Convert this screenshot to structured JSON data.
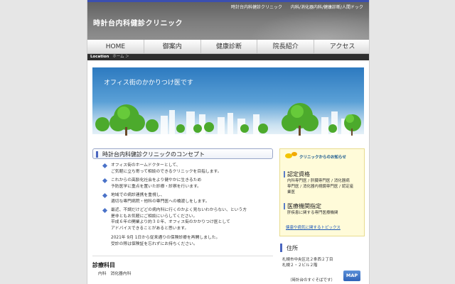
{
  "header": {
    "tagline_left": "時計台内科健診クリニック",
    "tagline_right": "内科/消化器内科/健康診断/人間ドック",
    "site_title": "時計台内科健診クリニック"
  },
  "nav": {
    "items": [
      "HOME",
      "御案内",
      "健康診断",
      "院長紹介",
      "アクセス"
    ]
  },
  "location_bar": {
    "label": "Location",
    "crumb": "ホーム ＞"
  },
  "hero": {
    "text": "オフィス街のかかりつけ医です"
  },
  "concept": {
    "title": "時計台内科健診クリニックのコンセプト",
    "paragraphs": [
      [
        "オフィス街のホームドクターとして、",
        "ご気軽に立ち寄って相談のできるクリニックを目指します。"
      ],
      [
        "これからの高齢化社会をより健やかに生きるため",
        "予防医学に重点を置いた診療・診察を行います。"
      ],
      [
        "地域での病診連携を重視し、",
        "適切な専門病院・他科の専門医への橋渡しをします。"
      ],
      [
        "最近、不調だけどどの病内科に行くのかよく見ないわからない、という方",
        "是非ともお気軽にご相談にいらしてください。",
        "平成６年の開業より約３０年、オフィス街のかかりつけ医として",
        "アドバイスできることがあると思います。"
      ]
    ],
    "notice": [
      "2021年 9月 1日から従来通りの保険診療を再開しました。",
      "受診の際は保険証を忘れずにお持ちください。"
    ]
  },
  "services": {
    "title": "診療科目",
    "body": "内科　消化器内科"
  },
  "sidebar": {
    "news_label": "クリニックからのお知らせ",
    "qualifications": {
      "heading": "認定資格",
      "lines": [
        "内科専門医 / 肝臓専門医 / 消化器病",
        "専門医 / 消化器内視鏡専門医 / 認定産",
        "業医"
      ]
    },
    "designation": {
      "heading": "医療機関指定",
      "lines": [
        "肝疾患に関する専門医療機関"
      ]
    },
    "link": "健康や病気に関するトピックス"
  },
  "address": {
    "heading": "住所",
    "lines": [
      "札幌市中央区北２条西２丁目",
      "札幌２・２ビル２階"
    ],
    "near": "（時計台のすぐそばです）",
    "map_label": "MAP"
  },
  "colors": {
    "accent_blue": "#4a66c0",
    "header_gray": "#7d7d7d",
    "sidebar_bg": "#fffbd9",
    "link_blue": "#1a56b8"
  }
}
